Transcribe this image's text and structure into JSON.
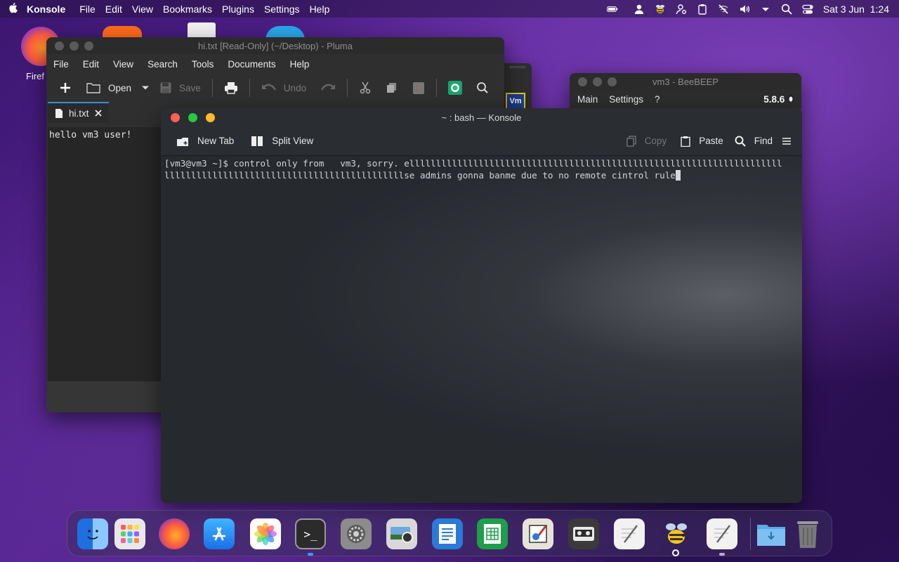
{
  "menubar": {
    "app_name": "Konsole",
    "items": [
      "File",
      "Edit",
      "View",
      "Bookmarks",
      "Plugins",
      "Settings",
      "Help"
    ],
    "clock": "Sat 3 Jun  1:24"
  },
  "desktop": {
    "firefox_label": "Firef"
  },
  "pluma": {
    "title": "hi.txt [Read-Only] (~/Desktop) - Pluma",
    "menu": [
      "File",
      "Edit",
      "View",
      "Search",
      "Tools",
      "Documents",
      "Help"
    ],
    "toolbar": {
      "open": "Open",
      "save": "Save",
      "undo": "Undo"
    },
    "tab_label": "hi.txt",
    "content": "hello vm3 user!"
  },
  "vm_window": {
    "label": "Vm"
  },
  "beebeep": {
    "title": "vm3 - BeeBEEP",
    "menu": [
      "Main",
      "Settings",
      "?"
    ],
    "version": "5.8.6"
  },
  "konsole": {
    "title": "~ : bash — Konsole",
    "toolbar": {
      "new_tab": "New Tab",
      "split_view": "Split View",
      "copy": "Copy",
      "paste": "Paste",
      "find": "Find"
    },
    "terminal_line1": "[vm3@vm3 ~]$ control only from   vm3, sorry. ellllllllllllllllllllllllllllllllllllllllllllllllllllllllllllllllllllll",
    "terminal_line2": "lllllllllllllllllllllllllllllllllllllllllllllse admins gonna banme due to no remote cintrol rule"
  },
  "dock": {
    "apps": [
      "finder",
      "launchpad",
      "firefox",
      "app-store",
      "photos",
      "terminal",
      "system-settings",
      "screenshot",
      "text-editor",
      "spreadsheet",
      "paint",
      "tape-recorder",
      "notes",
      "beebeep",
      "writer",
      "downloads",
      "trash"
    ]
  },
  "colors": {
    "close": "#ff5f57",
    "minimize": "#febc2e",
    "maximize": "#28c840",
    "accent": "#3d8fd6"
  }
}
